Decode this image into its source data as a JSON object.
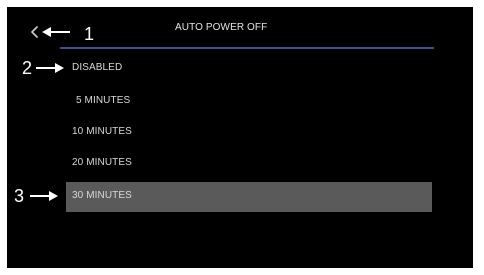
{
  "screen": {
    "title": "AUTO POWER OFF"
  },
  "callouts": {
    "back": "1",
    "first_item": "2",
    "selected_item": "3"
  },
  "menu": {
    "items": [
      {
        "label": "DISABLED"
      },
      {
        "label": "5 MINUTES"
      },
      {
        "label": "10 MINUTES"
      },
      {
        "label": "20 MINUTES"
      },
      {
        "label": "30 MINUTES"
      }
    ],
    "selected": "30 MINUTES"
  },
  "colors": {
    "background": "#000000",
    "divider": "#3f4e8c",
    "highlight": "#5a5a5a",
    "text": "#d8d8d8"
  },
  "icons": {
    "back": "chevron-left-icon",
    "callout_arrow": "arrow-right-icon"
  }
}
